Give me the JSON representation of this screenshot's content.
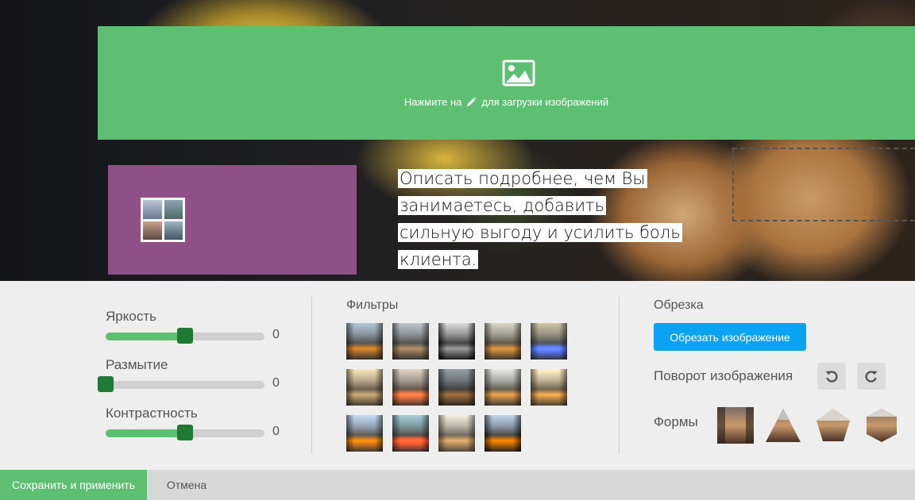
{
  "upload": {
    "text_before": "Нажмите на",
    "text_after": "для загрузки изображений",
    "icon": "image-icon",
    "pencil_icon": "pencil-icon"
  },
  "content": {
    "description_lines": [
      "Описать подробнее, чем Вы",
      "занимаетесь, добавить",
      "сильную выгоду и усилить боль",
      "клиента."
    ]
  },
  "sliders": [
    {
      "label": "Яркость",
      "value": "0",
      "position": 0.5
    },
    {
      "label": "Размытие",
      "value": "0",
      "position": 0.0
    },
    {
      "label": "Контрастность",
      "value": "0",
      "position": 0.5
    }
  ],
  "filters": {
    "title": "Фильтры",
    "count": 14
  },
  "crop": {
    "title": "Обрезка",
    "button_label": "Обрезать изображение",
    "rotate_label": "Поворот изображения",
    "rotate_left_icon": "rotate-left-icon",
    "rotate_right_icon": "rotate-right-icon",
    "shapes_label": "Формы",
    "shapes": [
      "square",
      "triangle",
      "pentagon",
      "hexagon"
    ]
  },
  "footer": {
    "save_label": "Сохранить и применить",
    "cancel_label": "Отмена"
  },
  "colors": {
    "accent_green": "#5cbf72",
    "slider_thumb": "#1e7a34",
    "crop_button": "#0aa2f2",
    "purple_block": "#8e5086"
  }
}
